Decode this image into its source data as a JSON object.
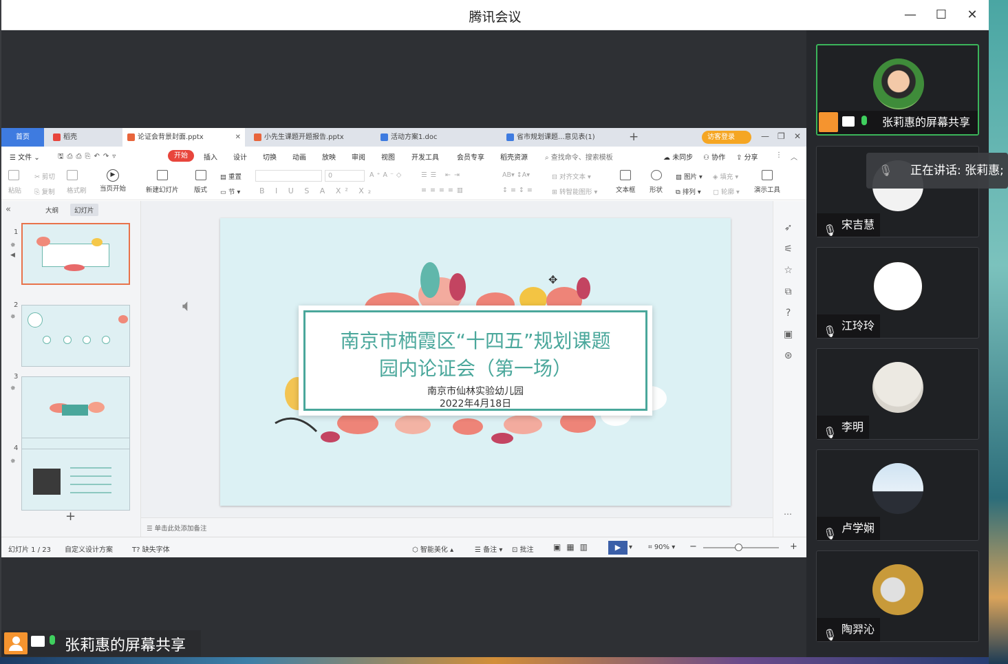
{
  "window": {
    "title": "腾讯会议",
    "minimize": "—",
    "maximize": "☐",
    "close": "✕"
  },
  "wps": {
    "tabs": [
      {
        "label": "首页"
      },
      {
        "label": "稻壳"
      },
      {
        "label": "论证会背景封面.pptx"
      },
      {
        "label": "小先生课题开题报告.pptx"
      },
      {
        "label": "活动方案1.doc"
      },
      {
        "label": "省市规划课题...意见表(1)"
      }
    ],
    "new_tab": "+",
    "login_btn": "访客登录",
    "menu": {
      "file": "文件",
      "start": "开始",
      "items": [
        "插入",
        "设计",
        "切换",
        "动画",
        "放映",
        "审阅",
        "视图",
        "开发工具",
        "会员专享",
        "稻壳资源"
      ],
      "search": "查找命令、搜索模板",
      "sync": "未同步",
      "collab": "协作",
      "share": "分享"
    },
    "ribbon": {
      "paste": "粘贴",
      "cut": "剪切",
      "copy": "复制",
      "format_painter": "格式刷",
      "from_current": "当页开始",
      "new_slide": "新建幻灯片",
      "layout": "版式",
      "reset": "重置",
      "section": "节",
      "font_size": "0",
      "align_text": "对齐文本",
      "smartart": "转智能图形",
      "textbox": "文本框",
      "shape": "形状",
      "picture": "图片",
      "arrange": "排列",
      "fill": "填充",
      "outline": "轮廓",
      "present_tools": "演示工具"
    },
    "panel_tabs": {
      "outline": "大纲",
      "slides": "幻灯片"
    },
    "thumbs": [
      "1",
      "2",
      "3",
      "4"
    ],
    "add_slide": "+",
    "slide": {
      "title_line1": "南京市栖霞区“十四五”规划课题",
      "title_line2": "园内论证会（第一场）",
      "org": "南京市仙林实验幼儿园",
      "date": "2022年4月18日"
    },
    "notes_placeholder": "单击此处添加备注",
    "status": {
      "slide_index": "幻灯片 1 / 23",
      "design": "自定义设计方案",
      "missing_font": "缺失字体",
      "beautify": "智能美化",
      "notes": "备注",
      "comment": "批注",
      "zoom": "90%"
    }
  },
  "share_label": "张莉惠的屏幕共享",
  "speaking": "正在讲话: 张莉惠;",
  "participants": [
    {
      "name": "张莉惠的屏幕共享"
    },
    {
      "name": "宋吉慧"
    },
    {
      "name": "江玲玲"
    },
    {
      "name": "李明"
    },
    {
      "name": "卢学娴"
    },
    {
      "name": "陶羿沁"
    }
  ],
  "colors": {
    "accent": "#3e7be0",
    "start": "#e8453c",
    "slide_teal": "#4aa79b",
    "active_border": "#3bb55a",
    "share_orange": "#f5942f"
  }
}
